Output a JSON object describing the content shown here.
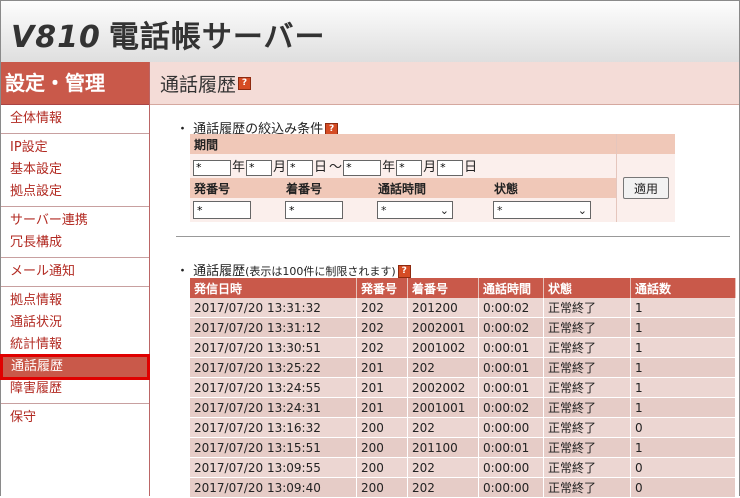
{
  "header": {
    "model": "V810",
    "title": "電話帳サーバー"
  },
  "sidebar": {
    "title": "設定・管理",
    "groups": [
      {
        "items": [
          {
            "label": "全体情報"
          }
        ]
      },
      {
        "items": [
          {
            "label": "IP設定"
          },
          {
            "label": "基本設定"
          },
          {
            "label": "拠点設定"
          }
        ]
      },
      {
        "items": [
          {
            "label": "サーバー連携"
          },
          {
            "label": "冗長構成"
          }
        ]
      },
      {
        "items": [
          {
            "label": "メール通知"
          }
        ]
      },
      {
        "items": [
          {
            "label": "拠点情報"
          },
          {
            "label": "通話状況"
          },
          {
            "label": "統計情報"
          },
          {
            "label": "通話履歴"
          },
          {
            "label": "障害履歴"
          }
        ]
      },
      {
        "items": [
          {
            "label": "保守"
          }
        ]
      }
    ],
    "active": "通話履歴"
  },
  "main": {
    "page_title": "通話履歴",
    "help_icon": "?",
    "filter": {
      "section_title": "・ 通話履歴の絞込み条件",
      "period_label": "期間",
      "date_values": [
        "*",
        "*",
        "*",
        "*",
        "*",
        "*"
      ],
      "units": [
        "年",
        "月",
        "日",
        "〜",
        "年",
        "月",
        "日"
      ],
      "caller_label": "発番号",
      "callee_label": "着番号",
      "duration_label": "通話時間",
      "status_label": "状態",
      "caller_value": "*",
      "callee_value": "*",
      "duration_value": "*",
      "status_value": "*",
      "apply_label": "適用"
    },
    "history": {
      "section_title": "・ 通話履歴",
      "section_note": "(表示は100件に制限されます)",
      "columns": [
        "発信日時",
        "発番号",
        "着番号",
        "通話時間",
        "状態",
        "通話数"
      ],
      "rows": [
        [
          "2017/07/20 13:31:32",
          "202",
          "201200",
          "0:00:02",
          "正常終了",
          "1"
        ],
        [
          "2017/07/20 13:31:12",
          "202",
          "2002001",
          "0:00:02",
          "正常終了",
          "1"
        ],
        [
          "2017/07/20 13:30:51",
          "202",
          "2001002",
          "0:00:01",
          "正常終了",
          "1"
        ],
        [
          "2017/07/20 13:25:22",
          "201",
          "202",
          "0:00:01",
          "正常終了",
          "1"
        ],
        [
          "2017/07/20 13:24:55",
          "201",
          "2002002",
          "0:00:01",
          "正常終了",
          "1"
        ],
        [
          "2017/07/20 13:24:31",
          "201",
          "2001001",
          "0:00:02",
          "正常終了",
          "1"
        ],
        [
          "2017/07/20 13:16:32",
          "200",
          "202",
          "0:00:00",
          "正常終了",
          "0"
        ],
        [
          "2017/07/20 13:15:51",
          "200",
          "201100",
          "0:00:01",
          "正常終了",
          "1"
        ],
        [
          "2017/07/20 13:09:55",
          "200",
          "202",
          "0:00:00",
          "正常終了",
          "0"
        ],
        [
          "2017/07/20 13:09:40",
          "200",
          "202",
          "0:00:00",
          "正常終了",
          "0"
        ]
      ]
    }
  },
  "colors": {
    "accent": "#c9594a",
    "active_outline": "#e00000",
    "link": "#b22a22"
  }
}
